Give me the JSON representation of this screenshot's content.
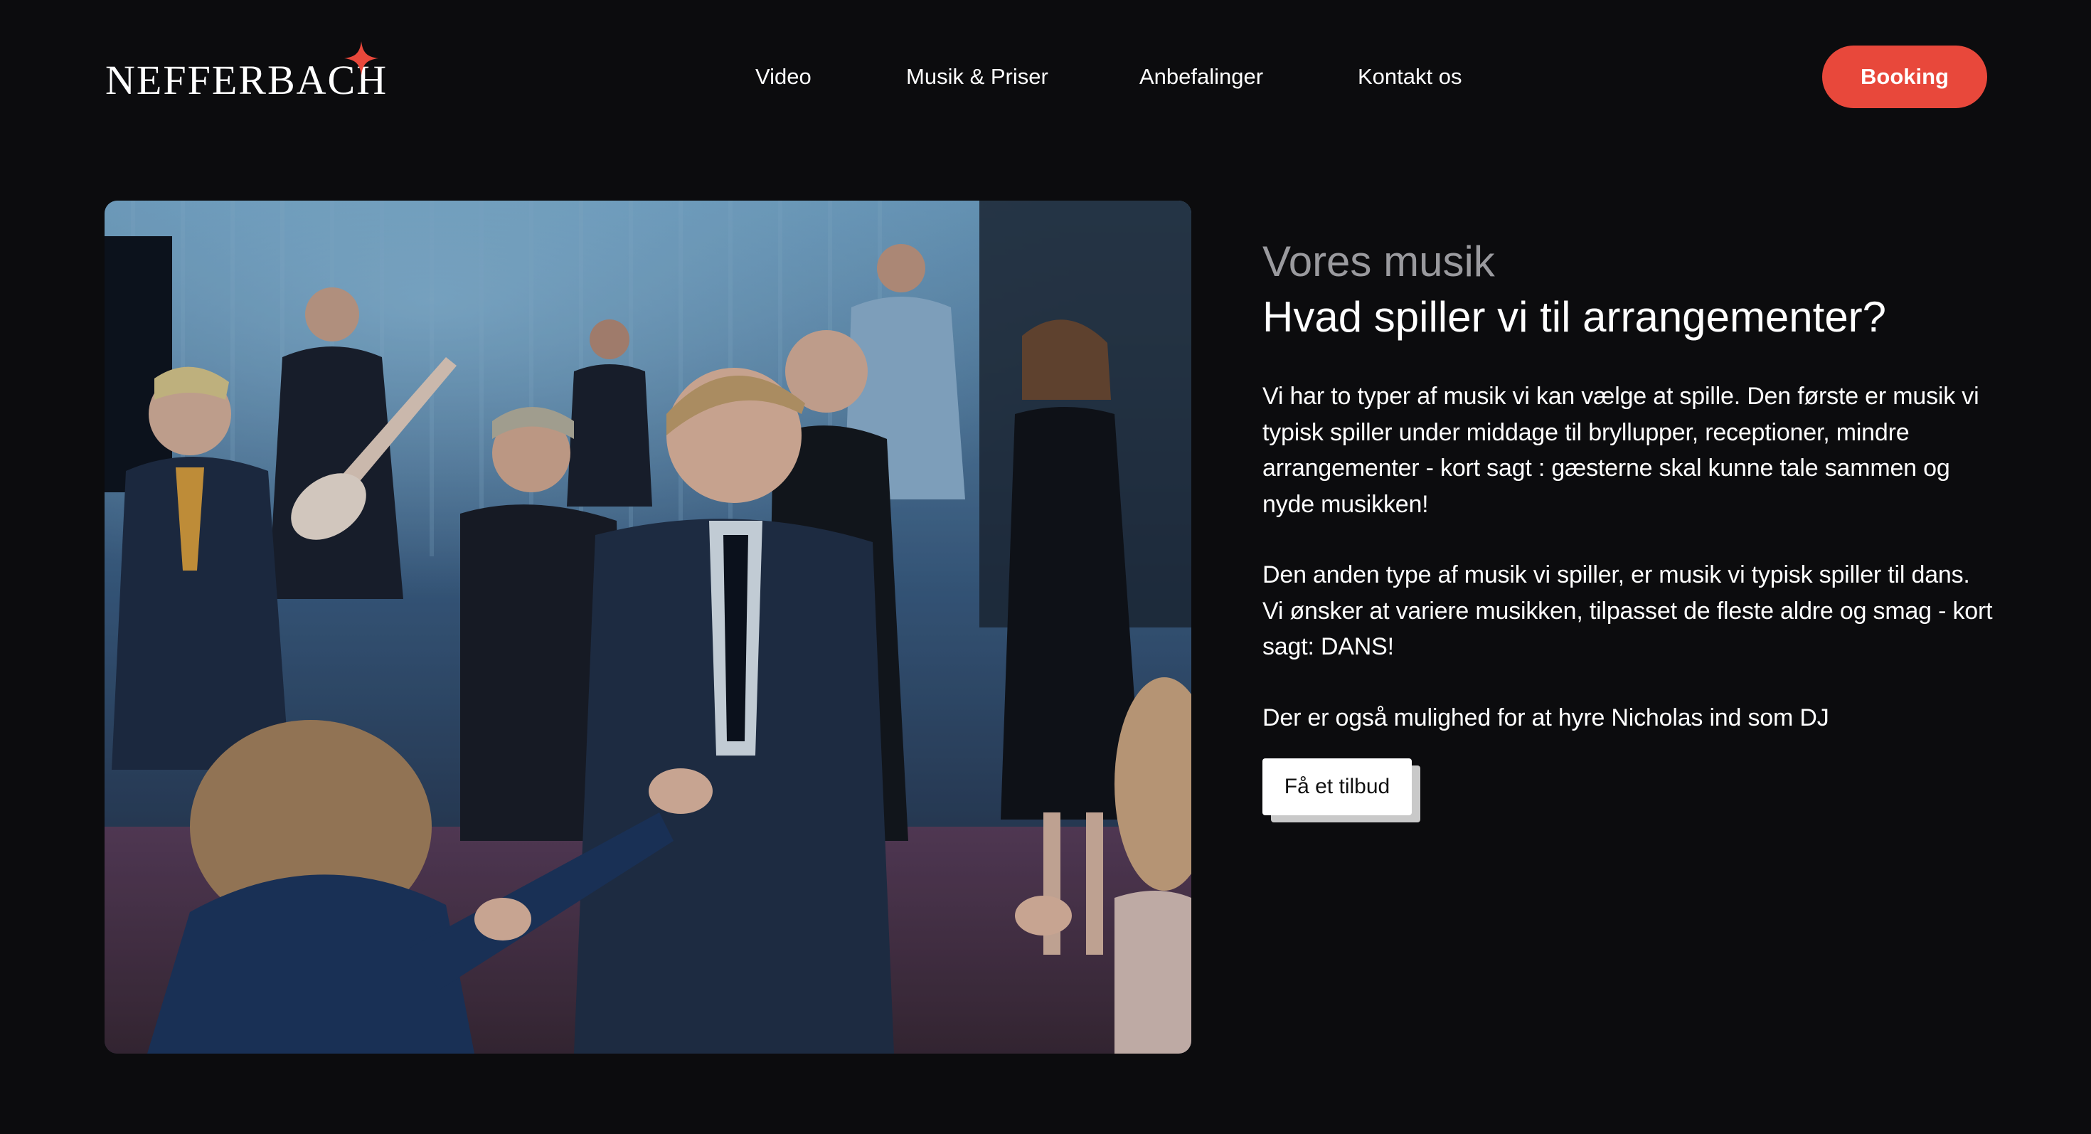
{
  "brand": {
    "name": "NEFFERBACH",
    "accent_color": "#e8483b",
    "star_icon": "sparkle-star-icon"
  },
  "nav": {
    "items": [
      {
        "label": "Video"
      },
      {
        "label": "Musik & Priser"
      },
      {
        "label": "Anbefalinger"
      },
      {
        "label": "Kontakt os"
      }
    ],
    "booking_label": "Booking"
  },
  "hero_image": {
    "subject": "wedding-dance-photo"
  },
  "section": {
    "eyebrow": "Vores musik",
    "headline": "Hvad spiller vi til arrangementer?",
    "paragraphs": [
      "Vi har to typer af musik vi kan vælge at spille. Den første er musik vi typisk spiller under middage til bryllupper, receptioner, mindre arrangementer - kort sagt : gæsterne skal kunne tale sammen og nyde musikken!",
      "Den anden type af musik vi spiller, er musik vi typisk spiller til dans. Vi ønsker at variere musikken, tilpasset de fleste aldre og smag - kort sagt: DANS!",
      "Der er også mulighed for at hyre Nicholas ind som DJ"
    ],
    "cta_label": "Få et tilbud"
  },
  "colors": {
    "background": "#0c0c0e",
    "eyebrow": "#9a9a9e",
    "booking_button": "#e8483b",
    "cta_background": "#ffffff"
  }
}
